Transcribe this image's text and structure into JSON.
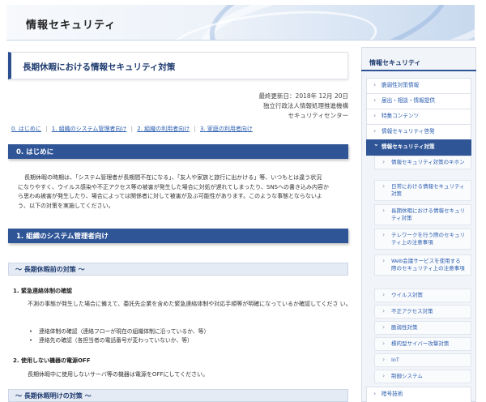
{
  "site": {
    "title": "情報セキュリティ"
  },
  "page": {
    "title": "長期休暇における情報セキュリティ対策",
    "updated": "最終更新日：2018年 12月 20日",
    "org1": "独立行政法人情報処理推進機構",
    "org2": "セキュリティセンター"
  },
  "toc": [
    "0. はじめに",
    "1. 組織のシステム管理者向け",
    "2. 組織の利用者向け",
    "3. 家庭の利用者向け"
  ],
  "sections": {
    "intro_heading": "0. はじめに",
    "intro_lines": [
      "長期休暇の時期は、「システム管理者が長期間不在になる」、「友人や家族と旅行に出かける」等、いつもとは違う状況",
      "になりやすく、ウイルス感染や不正アクセス等の被害が発生した場合に対処が遅れてしまったり、SNSへの書き込み内容か",
      "ら思わぬ被害が発生したり、場合によっては関係者に対して被害が及ぶ可能性があります。このような事態とならないよ",
      "う、以下の対策を実施してください。"
    ],
    "admin_heading": "1. 組織のシステム管理者向け",
    "before_heading": "〜 長期休暇前の対策 〜",
    "item1_heading": "1. 緊急連絡体制の確認",
    "item1_text": "不測の事態が発生した場合に備えて、委託先企業を含めた緊急連絡体制や対応手順等が明確になっているか確認してくださ い。",
    "item1_bullets": [
      "連絡体制の確認（連絡フローが現在の組織体制に沿っているか、等）",
      "連絡先の確認（各担当者の電話番号が変わっていないか、等）"
    ],
    "item2_heading": "2. 使用しない機器の電源OFF",
    "item2_text": "長期休暇中に使用しないサーバ等の機器は電源をOFFにしてください。",
    "after_heading": "〜 長期休暇明けの対策 〜"
  },
  "sidebar": {
    "title": "情報セキュリティ",
    "items": [
      "脆弱性対策情報",
      "届出・相談・情報提供",
      "特集コンテンツ",
      "情報セキュリティ啓発",
      "情報セキュリティ対策"
    ],
    "subitems": [
      "情報セキュリティ対策のキホン",
      "日常における情報セキュリティ対策",
      "長期休暇における情報セキュリティ対策",
      "テレワークを行う際のセキュリティ上の注意事項",
      "Web会議サービスを使用する際のセキュリティ上の注意事項",
      "ウイルス対策",
      "不正アクセス対策",
      "脆弱性対策",
      "標的型サイバー攻撃対策",
      "IoT",
      "制御システム"
    ],
    "bottom_item": "暗号技術"
  }
}
